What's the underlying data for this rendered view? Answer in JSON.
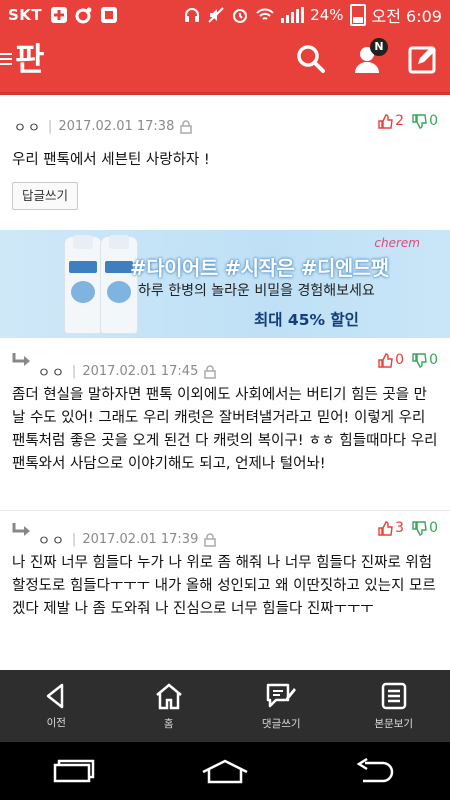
{
  "status_bar": {
    "carrier": "SKT",
    "battery": "24%",
    "time": "오전 6:09",
    "battery_level": 0.24
  },
  "header": {
    "logo": "판",
    "notification_badge": "N",
    "icons": [
      "menu-icon",
      "search-icon",
      "profile-icon",
      "compose-icon"
    ]
  },
  "comments": [
    {
      "author": "ㅇㅇ",
      "date": "2017.02.01 17:38",
      "up": "2",
      "down": "0",
      "text": "우리 팬톡에서 세븐틴 사랑하자 !",
      "reply_label": "답글쓰기",
      "is_reply": false
    },
    {
      "author": "ㅇㅇ",
      "date": "2017.02.01 17:45",
      "up": "0",
      "down": "0",
      "text": "좀더 현실을 말하자면 팬톡 이외에도 사회에서는 버티기 힘든 곳을 만날 수도 있어! 그래도 우리 캐럿은 잘버텨낼거라고 믿어! 이렇게 우리 팬톡처럼 좋은 곳을 오게 된건 다 캐럿의 복이구! ㅎㅎ 힘들때마다 우리 팬톡와서 사담으로 이야기해도 되고, 언제나 털어놔!",
      "is_reply": true
    },
    {
      "author": "ㅇㅇ",
      "date": "2017.02.01 17:39",
      "up": "3",
      "down": "0",
      "text": "나 진짜 너무 힘들다 누가 나 위로 좀 해줘 나 너무 힘들다 진짜로 위험할정도로 힘들다ㅜㅜㅜ 내가 올해 성인되고 왜 이딴짓하고 있는지 모르겠다 제발 나 좀 도와줘 나 진심으로 너무 힘들다 진짜ㅜㅜㅜ",
      "is_reply": true
    }
  ],
  "ad": {
    "brand": "cherem",
    "headline": "#다이어트 #시작은 #디엔드팻",
    "subline": "하루 한병의 놀라운 비밀을 경험해보세요",
    "discount": "최대 45% 할인"
  },
  "bottom_bar": {
    "items": [
      {
        "label": "이전",
        "icon": "back-icon"
      },
      {
        "label": "홈",
        "icon": "home-icon"
      },
      {
        "label": "댓글쓰기",
        "icon": "comment-write-icon"
      },
      {
        "label": "본문보기",
        "icon": "article-icon"
      }
    ]
  },
  "colors": {
    "brand_red": "#e8403a",
    "upvote": "#e8403a",
    "downvote": "#3aa55a",
    "action_bar": "#2e2e2e"
  }
}
